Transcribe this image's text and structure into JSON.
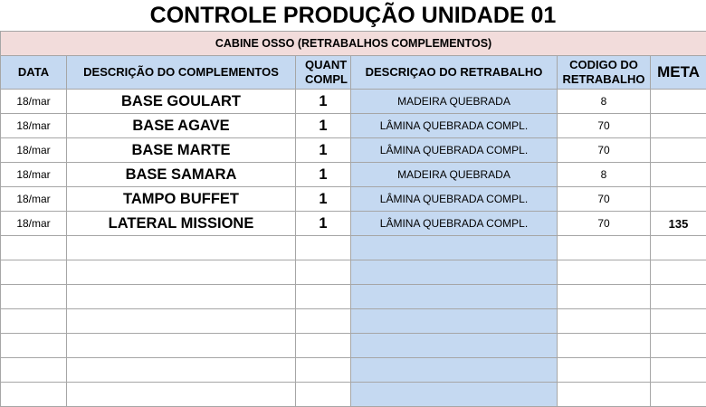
{
  "title": "CONTROLE PRODUÇÃO UNIDADE 01",
  "subtitle": "CABINE OSSO (RETRABALHOS COMPLEMENTOS)",
  "headers": {
    "data": "DATA",
    "descricao_complementos": "DESCRIÇÃO DO COMPLEMENTOS",
    "quant_compl": "QUANT COMPL",
    "descricao_retrabalho": "DESCRIÇAO DO RETRABALHO",
    "codigo_retrabalho": "CODIGO DO RETRABALHO",
    "meta": "META"
  },
  "rows": [
    {
      "data": "18/mar",
      "descricao": "BASE GOULART",
      "quant": "1",
      "retrabalho": "MADEIRA QUEBRADA",
      "codigo": "8",
      "meta": ""
    },
    {
      "data": "18/mar",
      "descricao": "BASE AGAVE",
      "quant": "1",
      "retrabalho": "LÂMINA QUEBRADA COMPL.",
      "codigo": "70",
      "meta": ""
    },
    {
      "data": "18/mar",
      "descricao": "BASE MARTE",
      "quant": "1",
      "retrabalho": "LÂMINA QUEBRADA COMPL.",
      "codigo": "70",
      "meta": ""
    },
    {
      "data": "18/mar",
      "descricao": "BASE SAMARA",
      "quant": "1",
      "retrabalho": "MADEIRA QUEBRADA",
      "codigo": "8",
      "meta": ""
    },
    {
      "data": "18/mar",
      "descricao": "TAMPO BUFFET",
      "quant": "1",
      "retrabalho": "LÂMINA QUEBRADA COMPL.",
      "codigo": "70",
      "meta": ""
    },
    {
      "data": "18/mar",
      "descricao": "LATERAL MISSIONE",
      "quant": "1",
      "retrabalho": "LÂMINA QUEBRADA COMPL.",
      "codigo": "70",
      "meta": "135"
    },
    {
      "data": "",
      "descricao": "",
      "quant": "",
      "retrabalho": "",
      "codigo": "",
      "meta": ""
    },
    {
      "data": "",
      "descricao": "",
      "quant": "",
      "retrabalho": "",
      "codigo": "",
      "meta": ""
    },
    {
      "data": "",
      "descricao": "",
      "quant": "",
      "retrabalho": "",
      "codigo": "",
      "meta": ""
    },
    {
      "data": "",
      "descricao": "",
      "quant": "",
      "retrabalho": "",
      "codigo": "",
      "meta": ""
    },
    {
      "data": "",
      "descricao": "",
      "quant": "",
      "retrabalho": "",
      "codigo": "",
      "meta": ""
    },
    {
      "data": "",
      "descricao": "",
      "quant": "",
      "retrabalho": "",
      "codigo": "",
      "meta": ""
    },
    {
      "data": "",
      "descricao": "",
      "quant": "",
      "retrabalho": "",
      "codigo": "",
      "meta": ""
    }
  ]
}
